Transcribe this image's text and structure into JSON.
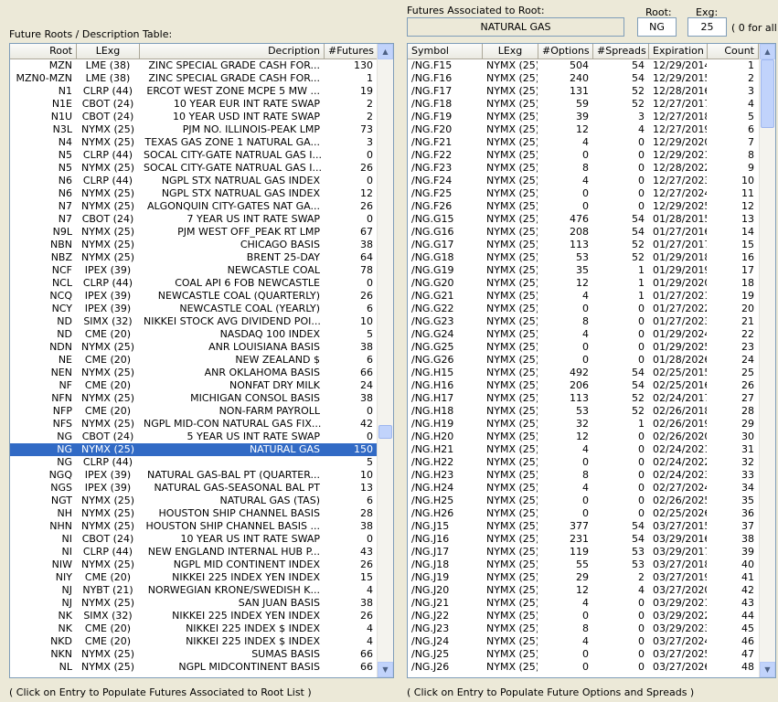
{
  "left_panel": {
    "title": "Future Roots / Description Table:",
    "columns": [
      "Root",
      "LExg",
      "Decription",
      "#Futures"
    ],
    "rows": [
      [
        "MZN",
        "LME  (38)",
        "ZINC SPECIAL GRADE CASH FOR...",
        "130"
      ],
      [
        "MZN0-MZN",
        "LME  (38)",
        "ZINC SPECIAL GRADE CASH FOR...",
        "1"
      ],
      [
        "N1",
        "CLRP (44)",
        "ERCOT WEST ZONE MCPE 5 MW ...",
        "19"
      ],
      [
        "N1E",
        "CBOT (24)",
        "10 YEAR EUR INT RATE SWAP",
        "2"
      ],
      [
        "N1U",
        "CBOT (24)",
        "10 YEAR USD INT RATE SWAP",
        "2"
      ],
      [
        "N3L",
        "NYMX (25)",
        "PJM NO. ILLINOIS-PEAK LMP",
        "73"
      ],
      [
        "N4",
        "NYMX (25)",
        "TEXAS GAS ZONE 1 NATURAL GA...",
        "3"
      ],
      [
        "N5",
        "CLRP (44)",
        "SOCAL CITY-GATE NATRUAL GAS I...",
        "0"
      ],
      [
        "N5",
        "NYMX (25)",
        "SOCAL CITY-GATE NATRUAL GAS I...",
        "26"
      ],
      [
        "N6",
        "CLRP (44)",
        "NGPL STX NATRUAL GAS INDEX",
        "0"
      ],
      [
        "N6",
        "NYMX (25)",
        "NGPL STX NATRUAL GAS INDEX",
        "12"
      ],
      [
        "N7",
        "NYMX (25)",
        "ALGONQUIN CITY-GATES NAT GA...",
        "26"
      ],
      [
        "N7",
        "CBOT (24)",
        "7 YEAR US INT RATE SWAP",
        "0"
      ],
      [
        "N9L",
        "NYMX (25)",
        "PJM WEST OFF_PEAK RT LMP",
        "67"
      ],
      [
        "NBN",
        "NYMX (25)",
        "CHICAGO BASIS",
        "38"
      ],
      [
        "NBZ",
        "NYMX (25)",
        "BRENT 25-DAY",
        "64"
      ],
      [
        "NCF",
        "IPEX (39)",
        "NEWCASTLE COAL",
        "78"
      ],
      [
        "NCL",
        "CLRP (44)",
        "COAL API 6 FOB NEWCASTLE",
        "0"
      ],
      [
        "NCQ",
        "IPEX (39)",
        "NEWCASTLE COAL (QUARTERLY)",
        "26"
      ],
      [
        "NCY",
        "IPEX (39)",
        "NEWCASTLE COAL (YEARLY)",
        "6"
      ],
      [
        "ND",
        "SIMX (32)",
        "NIKKEI STOCK AVG DIVIDEND POI...",
        "10"
      ],
      [
        "ND",
        "CME  (20)",
        "NASDAQ 100 INDEX",
        "5"
      ],
      [
        "NDN",
        "NYMX (25)",
        "ANR LOUISIANA BASIS",
        "38"
      ],
      [
        "NE",
        "CME  (20)",
        "NEW ZEALAND $",
        "6"
      ],
      [
        "NEN",
        "NYMX (25)",
        "ANR OKLAHOMA BASIS",
        "66"
      ],
      [
        "NF",
        "CME  (20)",
        "NONFAT DRY MILK",
        "24"
      ],
      [
        "NFN",
        "NYMX (25)",
        "MICHIGAN CONSOL BASIS",
        "38"
      ],
      [
        "NFP",
        "CME  (20)",
        "NON-FARM PAYROLL",
        "0"
      ],
      [
        "NFS",
        "NYMX (25)",
        "NGPL MID-CON NATURAL GAS FIX...",
        "42"
      ],
      [
        "NG",
        "CBOT (24)",
        "5 YEAR US INT RATE SWAP",
        "0"
      ],
      [
        "NG",
        "NYMX (25)",
        "NATURAL GAS",
        "150"
      ],
      [
        "NG",
        "CLRP (44)",
        "",
        "5"
      ],
      [
        "NGQ",
        "IPEX (39)",
        "NATURAL GAS-BAL PT (QUARTER...",
        "10"
      ],
      [
        "NGS",
        "IPEX (39)",
        "NATURAL GAS-SEASONAL BAL PT",
        "13"
      ],
      [
        "NGT",
        "NYMX (25)",
        "NATURAL GAS (TAS)",
        "6"
      ],
      [
        "NH",
        "NYMX (25)",
        "HOUSTON SHIP CHANNEL BASIS",
        "28"
      ],
      [
        "NHN",
        "NYMX (25)",
        "HOUSTON SHIP CHANNEL BASIS ...",
        "38"
      ],
      [
        "NI",
        "CBOT (24)",
        "10 YEAR US INT RATE SWAP",
        "0"
      ],
      [
        "NI",
        "CLRP (44)",
        "NEW ENGLAND INTERNAL HUB P...",
        "43"
      ],
      [
        "NIW",
        "NYMX (25)",
        "NGPL MID CONTINENT INDEX",
        "26"
      ],
      [
        "NIY",
        "CME  (20)",
        "NIKKEI 225 INDEX YEN INDEX",
        "15"
      ],
      [
        "NJ",
        "NYBT (21)",
        "NORWEGIAN KRONE/SWEDISH K...",
        "4"
      ],
      [
        "NJ",
        "NYMX (25)",
        "SAN JUAN BASIS",
        "38"
      ],
      [
        "NK",
        "SIMX (32)",
        "NIKKEI 225 INDEX YEN INDEX",
        "26"
      ],
      [
        "NK",
        "CME  (20)",
        "NIKKEI 225 INDEX $ INDEX",
        "4"
      ],
      [
        "NKD",
        "CME  (20)",
        "NIKKEI 225 INDEX $ INDEX",
        "4"
      ],
      [
        "NKN",
        "NYMX (25)",
        "SUMAS BASIS",
        "66"
      ],
      [
        "NL",
        "NYMX (25)",
        "NGPL MIDCONTINENT BASIS",
        "66"
      ]
    ],
    "footer": "( Click on Entry to Populate Futures Associated to Root List )"
  },
  "right_panel": {
    "title": "Futures Associated to Root:",
    "root_description": "NATURAL GAS",
    "root_label": "Root:",
    "root_value": "NG",
    "exg_label": "Exg:",
    "exg_value": "25",
    "exg_hint": "( 0 for all )",
    "columns": [
      "Symbol",
      "LExg",
      "#Options",
      "#Spreads",
      "Expiration",
      "Count"
    ],
    "rows": [
      [
        "/NG.F15",
        "NYMX (25)",
        "504",
        "54",
        "12/29/2014",
        "1"
      ],
      [
        "/NG.F16",
        "NYMX (25)",
        "240",
        "54",
        "12/29/2015",
        "2"
      ],
      [
        "/NG.F17",
        "NYMX (25)",
        "131",
        "52",
        "12/28/2016",
        "3"
      ],
      [
        "/NG.F18",
        "NYMX (25)",
        "59",
        "52",
        "12/27/2017",
        "4"
      ],
      [
        "/NG.F19",
        "NYMX (25)",
        "39",
        "3",
        "12/27/2018",
        "5"
      ],
      [
        "/NG.F20",
        "NYMX (25)",
        "12",
        "4",
        "12/27/2019",
        "6"
      ],
      [
        "/NG.F21",
        "NYMX (25)",
        "4",
        "0",
        "12/29/2020",
        "7"
      ],
      [
        "/NG.F22",
        "NYMX (25)",
        "0",
        "0",
        "12/29/2021",
        "8"
      ],
      [
        "/NG.F23",
        "NYMX (25)",
        "8",
        "0",
        "12/28/2022",
        "9"
      ],
      [
        "/NG.F24",
        "NYMX (25)",
        "4",
        "0",
        "12/27/2023",
        "10"
      ],
      [
        "/NG.F25",
        "NYMX (25)",
        "0",
        "0",
        "12/27/2024",
        "11"
      ],
      [
        "/NG.F26",
        "NYMX (25)",
        "0",
        "0",
        "12/29/2025",
        "12"
      ],
      [
        "/NG.G15",
        "NYMX (25)",
        "476",
        "54",
        "01/28/2015",
        "13"
      ],
      [
        "/NG.G16",
        "NYMX (25)",
        "208",
        "54",
        "01/27/2016",
        "14"
      ],
      [
        "/NG.G17",
        "NYMX (25)",
        "113",
        "52",
        "01/27/2017",
        "15"
      ],
      [
        "/NG.G18",
        "NYMX (25)",
        "53",
        "52",
        "01/29/2018",
        "16"
      ],
      [
        "/NG.G19",
        "NYMX (25)",
        "35",
        "1",
        "01/29/2019",
        "17"
      ],
      [
        "/NG.G20",
        "NYMX (25)",
        "12",
        "1",
        "01/29/2020",
        "18"
      ],
      [
        "/NG.G21",
        "NYMX (25)",
        "4",
        "1",
        "01/27/2021",
        "19"
      ],
      [
        "/NG.G22",
        "NYMX (25)",
        "0",
        "0",
        "01/27/2022",
        "20"
      ],
      [
        "/NG.G23",
        "NYMX (25)",
        "8",
        "0",
        "01/27/2023",
        "21"
      ],
      [
        "/NG.G24",
        "NYMX (25)",
        "4",
        "0",
        "01/29/2024",
        "22"
      ],
      [
        "/NG.G25",
        "NYMX (25)",
        "0",
        "0",
        "01/29/2025",
        "23"
      ],
      [
        "/NG.G26",
        "NYMX (25)",
        "0",
        "0",
        "01/28/2026",
        "24"
      ],
      [
        "/NG.H15",
        "NYMX (25)",
        "492",
        "54",
        "02/25/2015",
        "25"
      ],
      [
        "/NG.H16",
        "NYMX (25)",
        "206",
        "54",
        "02/25/2016",
        "26"
      ],
      [
        "/NG.H17",
        "NYMX (25)",
        "113",
        "52",
        "02/24/2017",
        "27"
      ],
      [
        "/NG.H18",
        "NYMX (25)",
        "53",
        "52",
        "02/26/2018",
        "28"
      ],
      [
        "/NG.H19",
        "NYMX (25)",
        "32",
        "1",
        "02/26/2019",
        "29"
      ],
      [
        "/NG.H20",
        "NYMX (25)",
        "12",
        "0",
        "02/26/2020",
        "30"
      ],
      [
        "/NG.H21",
        "NYMX (25)",
        "4",
        "0",
        "02/24/2021",
        "31"
      ],
      [
        "/NG.H22",
        "NYMX (25)",
        "0",
        "0",
        "02/24/2022",
        "32"
      ],
      [
        "/NG.H23",
        "NYMX (25)",
        "8",
        "0",
        "02/24/2023",
        "33"
      ],
      [
        "/NG.H24",
        "NYMX (25)",
        "4",
        "0",
        "02/27/2024",
        "34"
      ],
      [
        "/NG.H25",
        "NYMX (25)",
        "0",
        "0",
        "02/26/2025",
        "35"
      ],
      [
        "/NG.H26",
        "NYMX (25)",
        "0",
        "0",
        "02/25/2026",
        "36"
      ],
      [
        "/NG.J15",
        "NYMX (25)",
        "377",
        "54",
        "03/27/2015",
        "37"
      ],
      [
        "/NG.J16",
        "NYMX (25)",
        "231",
        "54",
        "03/29/2016",
        "38"
      ],
      [
        "/NG.J17",
        "NYMX (25)",
        "119",
        "53",
        "03/29/2017",
        "39"
      ],
      [
        "/NG.J18",
        "NYMX (25)",
        "55",
        "53",
        "03/27/2018",
        "40"
      ],
      [
        "/NG.J19",
        "NYMX (25)",
        "29",
        "2",
        "03/27/2019",
        "41"
      ],
      [
        "/NG.J20",
        "NYMX (25)",
        "12",
        "4",
        "03/27/2020",
        "42"
      ],
      [
        "/NG.J21",
        "NYMX (25)",
        "4",
        "0",
        "03/29/2021",
        "43"
      ],
      [
        "/NG.J22",
        "NYMX (25)",
        "0",
        "0",
        "03/29/2022",
        "44"
      ],
      [
        "/NG.J23",
        "NYMX (25)",
        "8",
        "0",
        "03/29/2023",
        "45"
      ],
      [
        "/NG.J24",
        "NYMX (25)",
        "4",
        "0",
        "03/27/2024",
        "46"
      ],
      [
        "/NG.J25",
        "NYMX (25)",
        "0",
        "0",
        "03/27/2025",
        "47"
      ],
      [
        "/NG.J26",
        "NYMX (25)",
        "0",
        "0",
        "03/27/2026",
        "48"
      ]
    ],
    "footer": "( Click on Entry to Populate Future Options and Spreads )"
  },
  "icons": {
    "scroll_up": "scroll-up-arrow-icon",
    "scroll_down": "scroll-down-arrow-icon"
  },
  "colors": {
    "selection": "#316ac5",
    "window_bg": "#ece9d8",
    "border": "#7f9db9"
  }
}
